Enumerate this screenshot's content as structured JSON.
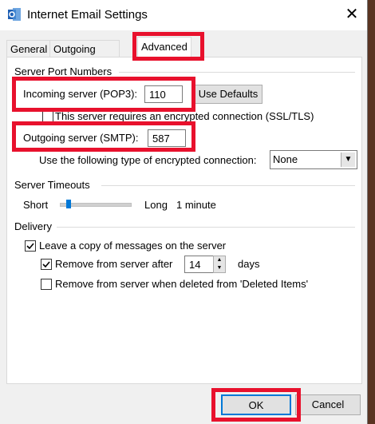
{
  "window": {
    "title": "Internet Email Settings",
    "close_glyph": "✕"
  },
  "tabs": [
    {
      "label": "General"
    },
    {
      "label": "Outgoing Server"
    },
    {
      "label": "Advanced"
    }
  ],
  "server_ports": {
    "heading": "Server Port Numbers",
    "incoming_label": "Incoming server (POP3):",
    "incoming_value": "110",
    "use_defaults": "Use Defaults",
    "ssl_label": "This server requires an encrypted connection (SSL/TLS)",
    "ssl_checked": false,
    "outgoing_label": "Outgoing server (SMTP):",
    "outgoing_value": "587",
    "encryption_label": "Use the following type of encrypted connection:",
    "encryption_value": "None"
  },
  "timeouts": {
    "heading": "Server Timeouts",
    "short": "Short",
    "long": "Long",
    "value": "1 minute",
    "slider_position": 0.1
  },
  "delivery": {
    "heading": "Delivery",
    "leave_copy_label": "Leave a copy of messages on the server",
    "leave_copy_checked": true,
    "remove_after_label": "Remove from server after",
    "remove_after_checked": true,
    "remove_days": "14",
    "days_label": "days",
    "remove_deleted_label": "Remove from server when deleted from 'Deleted Items'",
    "remove_deleted_checked": false
  },
  "footer": {
    "ok": "OK",
    "cancel": "Cancel"
  },
  "colors": {
    "highlight": "#e8112d",
    "accent": "#0078d7"
  }
}
